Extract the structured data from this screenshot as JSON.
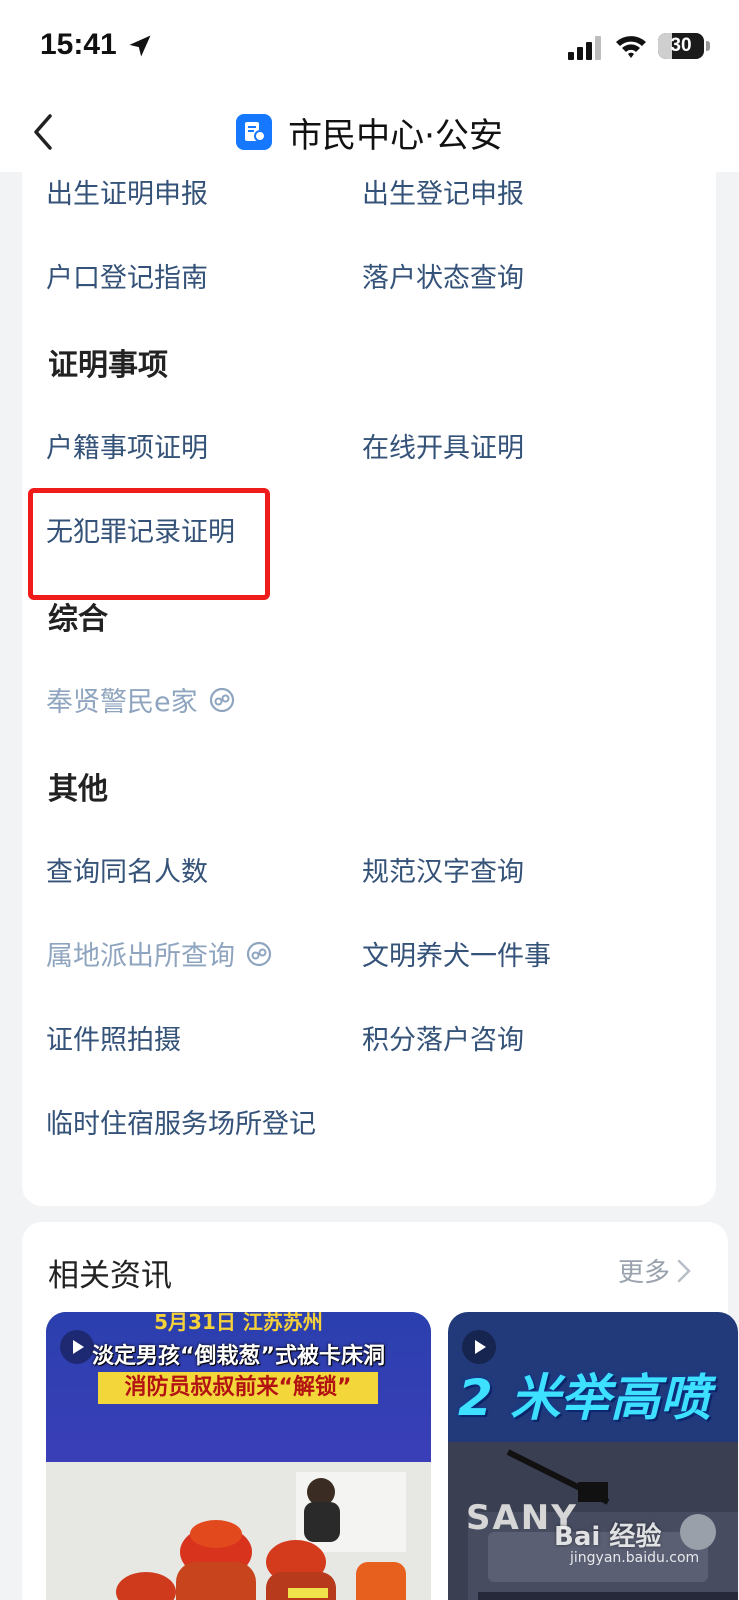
{
  "status_bar": {
    "time": "15:41",
    "battery": "30",
    "battery_fraction": 0.3
  },
  "nav": {
    "title": "市民中心·公安"
  },
  "services": {
    "row1": [
      "出生证明申报",
      "出生登记申报"
    ],
    "row2": [
      "户口登记指南",
      "落户状态查询"
    ],
    "section_certificates": "证明事项",
    "cert_items": [
      "户籍事项证明",
      "在线开具证明",
      "无犯罪记录证明"
    ],
    "section_general": "综合",
    "general_items": [
      "奉贤警民e家"
    ],
    "section_other": "其他",
    "other_items": [
      "查询同名人数",
      "规范汉字查询",
      "属地派出所查询",
      "文明养犬一件事",
      "证件照拍摄",
      "积分落户咨询",
      "临时住宿服务场所登记"
    ]
  },
  "news": {
    "title": "相关资讯",
    "more": "更多",
    "card1": {
      "date": "5月31日 江苏苏州",
      "headline": "淡定男孩“倒栽葱”式被卡床洞",
      "subhead": "消防员叔叔前来“解锁”"
    },
    "card2": {
      "headline": "2 米举高喷",
      "brand": "SANY"
    }
  },
  "watermark": {
    "logo": "Bai 经验",
    "url": "jingyan.baidu.com"
  },
  "colors": {
    "link": "#355379",
    "link_disabled": "#8fa5bf",
    "highlight": "#f01b1b",
    "accent": "#1677ff"
  }
}
